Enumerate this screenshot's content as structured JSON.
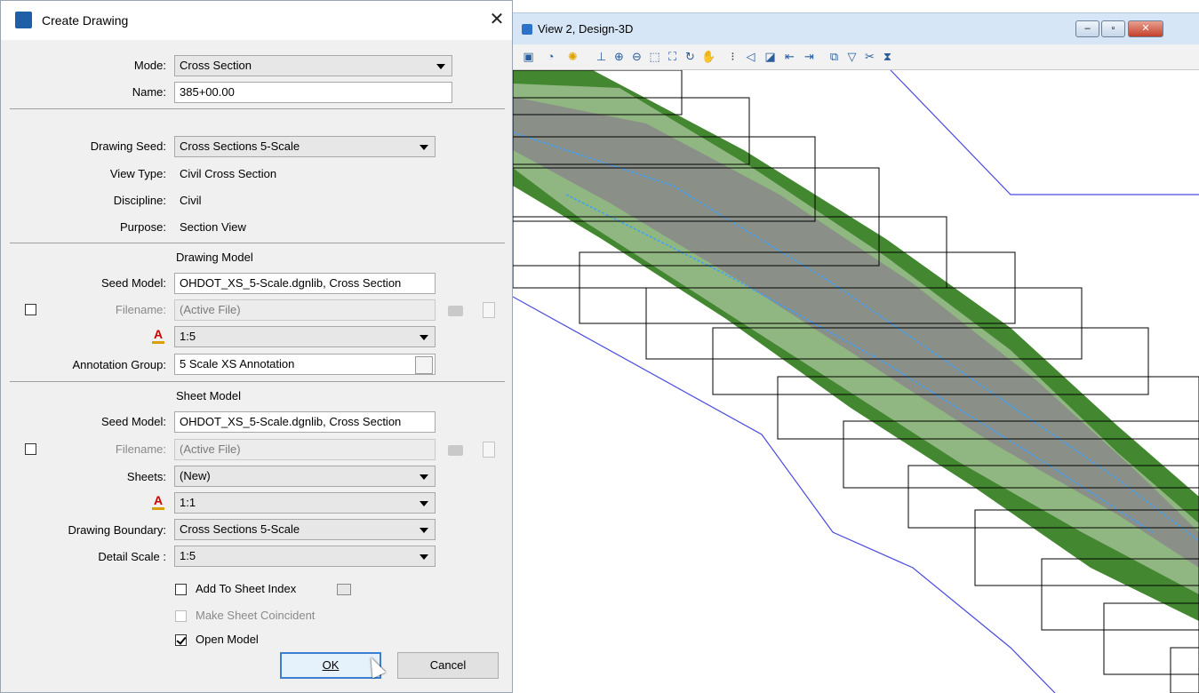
{
  "dialog": {
    "title": "Create Drawing",
    "close_glyph": "✕",
    "mode_label": "Mode:",
    "mode_value": "Cross Section",
    "name_label": "Name:",
    "name_value": "385+00.00",
    "drawing_seed_label": "Drawing Seed:",
    "drawing_seed_value": "Cross Sections 5-Scale",
    "view_type_label": "View Type:",
    "view_type_value": "Civil Cross Section",
    "discipline_label": "Discipline:",
    "discipline_value": "Civil",
    "purpose_label": "Purpose:",
    "purpose_value": "Section View",
    "drawing_model": {
      "header": "Drawing Model",
      "seed_model_label": "Seed Model:",
      "seed_model_value": "OHDOT_XS_5-Scale.dgnlib, Cross Section",
      "filename_label": "Filename:",
      "filename_value": "(Active File)",
      "filename_checked": false,
      "scale_value": "1:5",
      "annotation_group_label": "Annotation Group:",
      "annotation_group_value": "5 Scale XS Annotation"
    },
    "sheet_model": {
      "header": "Sheet Model",
      "seed_model_label": "Seed Model:",
      "seed_model_value": "OHDOT_XS_5-Scale.dgnlib, Cross Section",
      "filename_label": "Filename:",
      "filename_value": "(Active File)",
      "filename_checked": false,
      "sheets_label": "Sheets:",
      "sheets_value": "(New)",
      "scale_value": "1:1",
      "drawing_boundary_label": "Drawing Boundary:",
      "drawing_boundary_value": "Cross Sections 5-Scale",
      "detail_scale_label": "Detail Scale :",
      "detail_scale_value": "1:5"
    },
    "options": {
      "add_to_sheet_index": "Add To Sheet Index",
      "add_to_sheet_index_checked": false,
      "make_sheet_coincident": "Make Sheet Coincident",
      "make_sheet_coincident_checked": false,
      "open_model": "Open Model",
      "open_model_checked": true
    },
    "ok_button": "OK",
    "cancel_button": "Cancel"
  },
  "view": {
    "title": "View 2, Design-3D",
    "minimize_glyph": "–",
    "maximize_glyph": "▫",
    "close_glyph": "✕",
    "toolbar_icons": [
      "view-attributes-icon",
      "display-style-icon",
      "lights-icon",
      "clip-volume-icon",
      "zoom-in-icon",
      "zoom-out-icon",
      "zoom-area-icon",
      "fit-view-icon",
      "rotate-view-icon",
      "pan-icon",
      "walk-icon",
      "view-previous-icon",
      "view-next-icon",
      "copy-view-icon",
      "camera-icon",
      "clip-volume-tool-icon",
      "toggle-icon"
    ]
  },
  "colors": {
    "accent_blue": "#3c7fd2",
    "terrain_green": "#2f7a1a",
    "roadway_gray": "#8a8a8a",
    "boundary_line": "#3a3adf"
  }
}
